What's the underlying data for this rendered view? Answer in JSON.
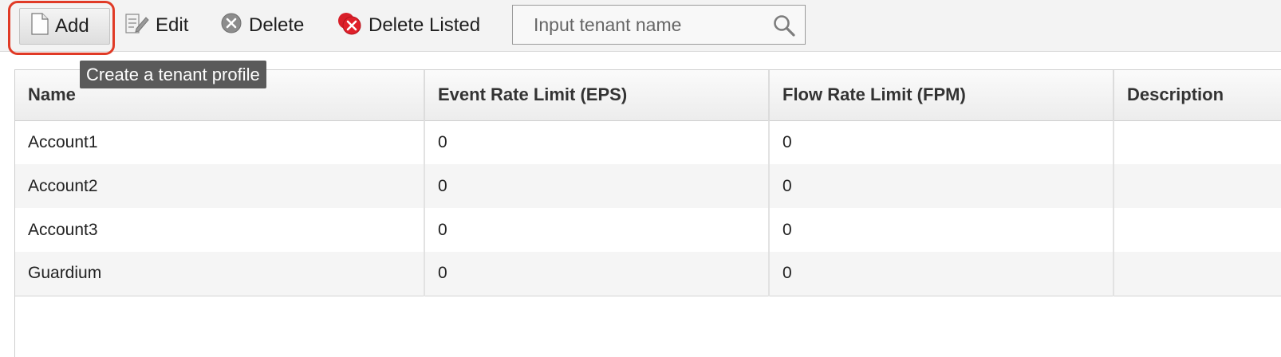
{
  "toolbar": {
    "add_label": "Add",
    "edit_label": "Edit",
    "delete_label": "Delete",
    "delete_listed_label": "Delete Listed",
    "search_placeholder": "Input tenant name",
    "search_value": ""
  },
  "tooltip": {
    "text": "Create a tenant profile"
  },
  "table": {
    "columns": [
      "Name",
      "Event Rate Limit (EPS)",
      "Flow Rate Limit (FPM)",
      "Description"
    ],
    "rows": [
      {
        "name": "Account1",
        "eps": "0",
        "fpm": "0",
        "description": ""
      },
      {
        "name": "Account2",
        "eps": "0",
        "fpm": "0",
        "description": ""
      },
      {
        "name": "Account3",
        "eps": "0",
        "fpm": "0",
        "description": ""
      },
      {
        "name": "Guardium",
        "eps": "0",
        "fpm": "0",
        "description": ""
      }
    ]
  },
  "icons": {
    "add": "new-document-icon",
    "edit": "edit-document-icon",
    "delete": "delete-circle-icon",
    "delete_listed": "delete-listed-icon",
    "search": "search-icon"
  },
  "colors": {
    "highlight": "#e03a26",
    "tooltip_bg": "#5a5a5a",
    "delete_icon": "#8c8c8c",
    "delete_listed_icon": "#e0202a"
  }
}
